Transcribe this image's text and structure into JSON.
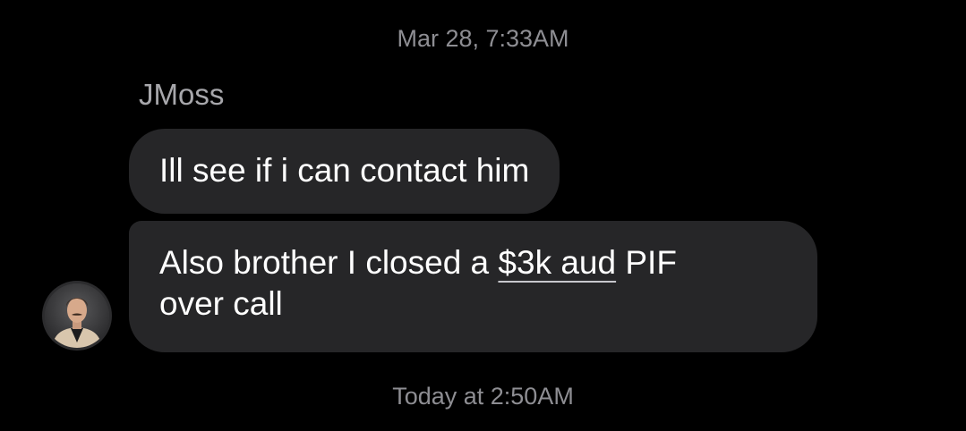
{
  "conversation": {
    "timestamp_top": "Mar 28, 7:33AM",
    "sender_name": "JMoss",
    "messages": [
      {
        "text": "Ill see if i can contact him"
      },
      {
        "line1_before": "Also brother I closed a ",
        "line1_link": "$3k aud",
        "line1_after": " PIF",
        "line2": "over call"
      }
    ],
    "timestamp_bottom": "Today at 2:50AM"
  },
  "avatar": {
    "icon": "user-avatar-photo"
  },
  "colors": {
    "background": "#000000",
    "bubble": "#262628",
    "timestamp": "#8e8e93",
    "sender_name": "#a7a7ab",
    "message_text": "#ffffff"
  }
}
